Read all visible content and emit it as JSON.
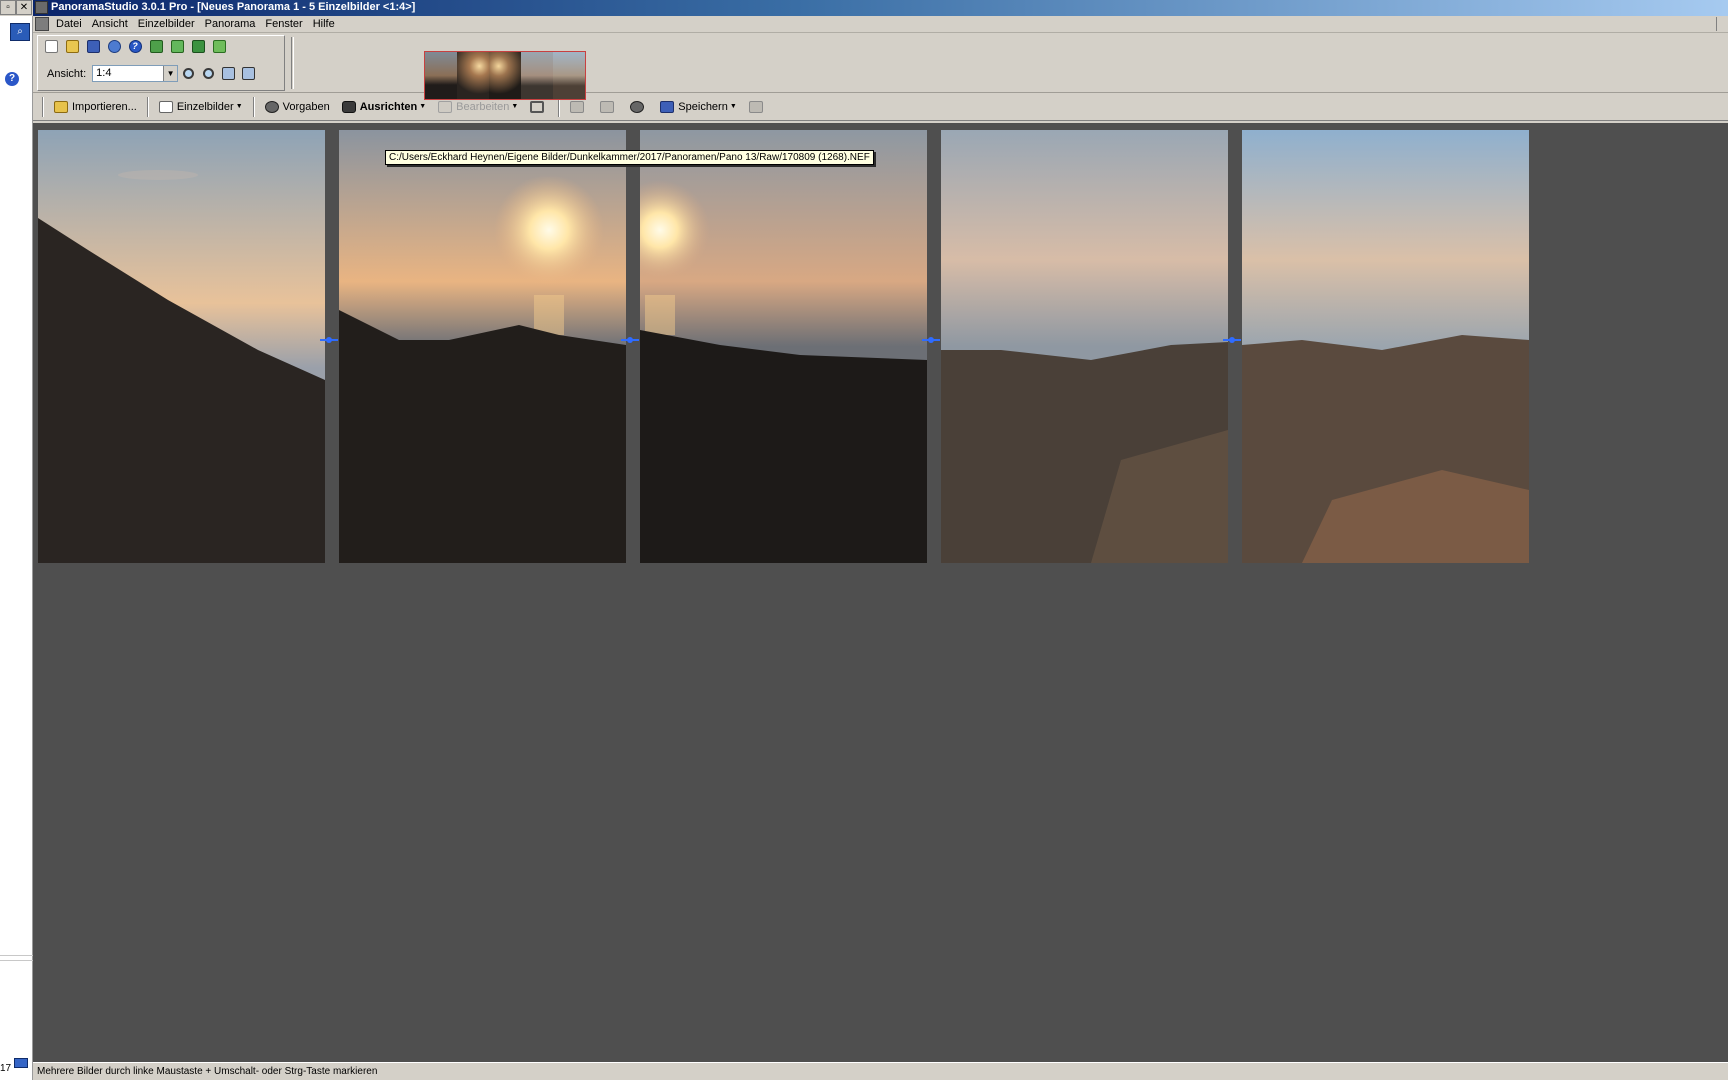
{
  "window": {
    "title": "PanoramaStudio 3.0.1 Pro - [Neues Panorama 1 - 5 Einzelbilder <1:4>]"
  },
  "menu": {
    "items": [
      "Datei",
      "Ansicht",
      "Einzelbilder",
      "Panorama",
      "Fenster",
      "Hilfe"
    ]
  },
  "view_toolbar": {
    "label": "Ansicht:",
    "zoom_value": "1:4"
  },
  "main_toolbar": {
    "import": "Importieren...",
    "images": "Einzelbilder",
    "presets": "Vorgaben",
    "align": "Ausrichten",
    "edit": "Bearbeiten",
    "save": "Speichern"
  },
  "tooltip": {
    "path": "C:/Users/Eckhard Heynen/Eigene Bilder/Dunkelkammer/2017/Panoramen/Pano 13/Raw/170809 (1268).NEF"
  },
  "photos": [
    {
      "sky_top": "#8ea3b6",
      "sky_mid": "#e8c29a",
      "ground": "#2a2522",
      "sun": false,
      "selected": true
    },
    {
      "sky_top": "#8b949f",
      "sky_mid": "#e9b482",
      "ground": "#221e1b",
      "sun": true,
      "selected": false
    },
    {
      "sky_top": "#8e98a2",
      "sky_mid": "#d8a883",
      "ground": "#1d1a18",
      "sun": true,
      "selected": false
    },
    {
      "sky_top": "#9aa7b4",
      "sky_mid": "#d7bca7",
      "ground": "#4a4038",
      "sun": false,
      "selected": false
    },
    {
      "sky_top": "#8fb0ce",
      "sky_mid": "#dac0a8",
      "ground": "#5a4a3e",
      "sun": false,
      "selected": false
    }
  ],
  "status": {
    "text": "Mehrere Bilder durch linke Maustaste + Umschalt- oder Strg-Taste markieren"
  },
  "outer": {
    "number": "17"
  }
}
